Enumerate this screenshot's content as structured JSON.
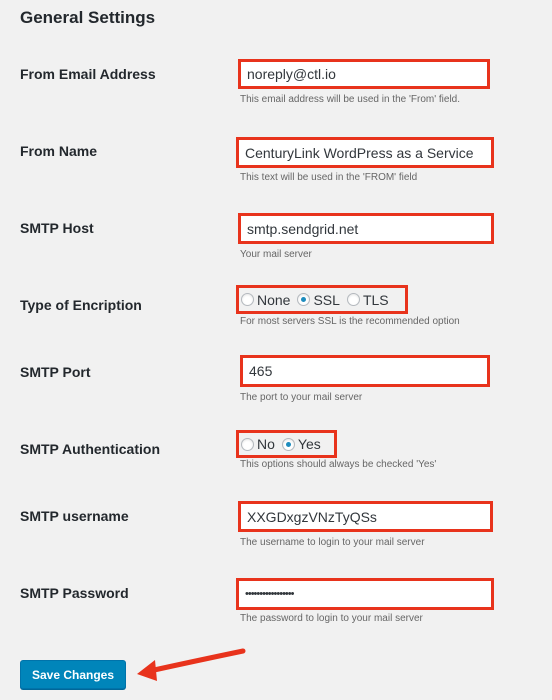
{
  "page": {
    "title": "General Settings"
  },
  "fields": {
    "from_email": {
      "label": "From Email Address",
      "value": "noreply@ctl.io",
      "desc": "This email address will be used in the 'From' field."
    },
    "from_name": {
      "label": "From Name",
      "value": "CenturyLink WordPress as a Service",
      "desc": "This text will be used in the 'FROM' field"
    },
    "smtp_host": {
      "label": "SMTP Host",
      "value": "smtp.sendgrid.net",
      "desc": "Your mail server"
    },
    "encryption": {
      "label": "Type of Encription",
      "options": [
        "None",
        "SSL",
        "TLS"
      ],
      "selected": "SSL",
      "desc": "For most servers SSL is the recommended option"
    },
    "smtp_port": {
      "label": "SMTP Port",
      "value": "465",
      "desc": "The port to your mail server"
    },
    "smtp_auth": {
      "label": "SMTP Authentication",
      "options": [
        "No",
        "Yes"
      ],
      "selected": "Yes",
      "desc": "This options should always be checked 'Yes'"
    },
    "smtp_username": {
      "label": "SMTP username",
      "value": "XXGDxgzVNzTyQSs",
      "desc": "The username to login to your mail server"
    },
    "smtp_password": {
      "label": "SMTP Password",
      "value": "•••••••••••••••••",
      "desc": "The password to login to your mail server"
    }
  },
  "actions": {
    "save_label": "Save Changes"
  },
  "colors": {
    "highlight": "#e8331c",
    "button": "#0085ba",
    "radio_checked": "#1e8cbe"
  }
}
